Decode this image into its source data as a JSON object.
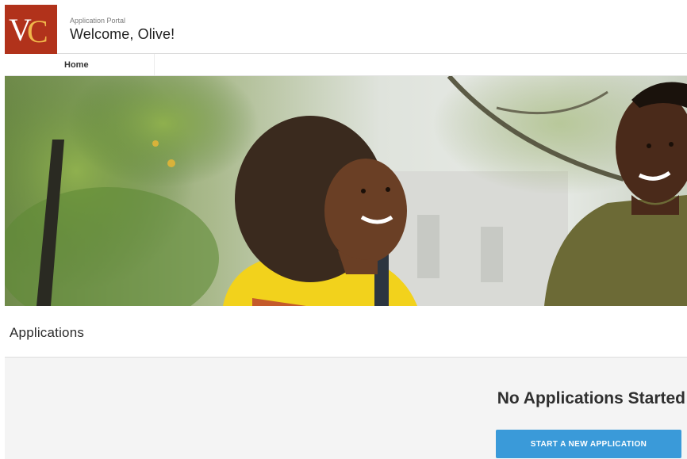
{
  "header": {
    "logo_text": "VC",
    "portal_label": "Application Portal",
    "welcome": "Welcome, Olive!"
  },
  "nav": {
    "tabs": [
      {
        "label": "Home"
      }
    ]
  },
  "applications": {
    "title": "Applications",
    "empty_message": "No Applications Started",
    "start_button_label": "START A NEW APPLICATION"
  },
  "colors": {
    "logo_bg": "#b1321b",
    "logo_v": "#ffffff",
    "logo_c": "#f0b64a",
    "button": "#3a9ad9",
    "empty_panel_bg": "#f4f4f4"
  },
  "icons": {
    "logo": "vc-monogram-logo"
  }
}
